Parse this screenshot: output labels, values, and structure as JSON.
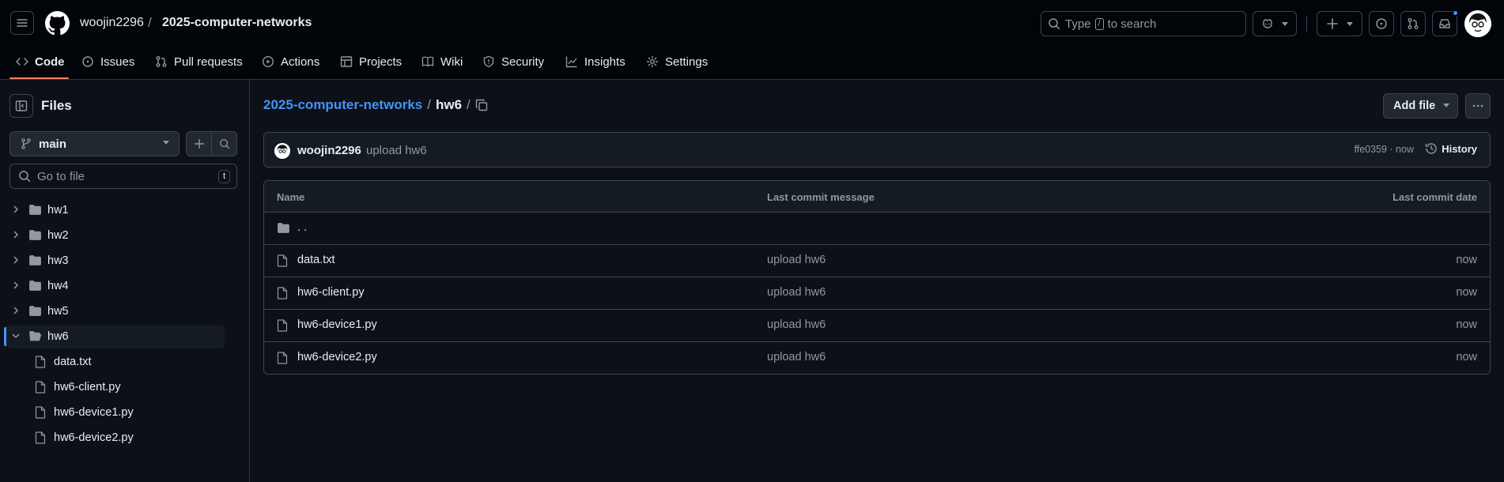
{
  "header": {
    "owner": "woojin2296",
    "separator": "/",
    "repo": "2025-computer-networks",
    "search_prefix": "Type",
    "search_key": "/",
    "search_suffix": "to search"
  },
  "tabs": [
    {
      "label": "Code",
      "icon": "code-icon"
    },
    {
      "label": "Issues",
      "icon": "issue-opened-icon"
    },
    {
      "label": "Pull requests",
      "icon": "git-pull-request-icon"
    },
    {
      "label": "Actions",
      "icon": "play-icon"
    },
    {
      "label": "Projects",
      "icon": "table-icon"
    },
    {
      "label": "Wiki",
      "icon": "book-icon"
    },
    {
      "label": "Security",
      "icon": "shield-icon"
    },
    {
      "label": "Insights",
      "icon": "graph-icon"
    },
    {
      "label": "Settings",
      "icon": "gear-icon"
    }
  ],
  "sidebar": {
    "title": "Files",
    "branch": "main",
    "goto_placeholder": "Go to file",
    "goto_key": "t",
    "folders": [
      "hw1",
      "hw2",
      "hw3",
      "hw4",
      "hw5",
      "hw6"
    ],
    "files": [
      "data.txt",
      "hw6-client.py",
      "hw6-device1.py",
      "hw6-device2.py"
    ]
  },
  "breadcrumb": {
    "repo": "2025-computer-networks",
    "sep1": "/",
    "folder": "hw6",
    "sep2": "/"
  },
  "actions": {
    "add_file": "Add file"
  },
  "commit": {
    "user": "woojin2296",
    "message": "upload hw6",
    "sha_time": "ffe0359 · now",
    "history": "History"
  },
  "table": {
    "col_name": "Name",
    "col_message": "Last commit message",
    "col_date": "Last commit date",
    "parent": ". .",
    "rows": [
      {
        "name": "data.txt",
        "message": "upload hw6",
        "date": "now"
      },
      {
        "name": "hw6-client.py",
        "message": "upload hw6",
        "date": "now"
      },
      {
        "name": "hw6-device1.py",
        "message": "upload hw6",
        "date": "now"
      },
      {
        "name": "hw6-device2.py",
        "message": "upload hw6",
        "date": "now"
      }
    ]
  },
  "colors": {
    "accent_link": "#4493f8",
    "tab_underline": "#f78166",
    "background": "#0d1117"
  }
}
